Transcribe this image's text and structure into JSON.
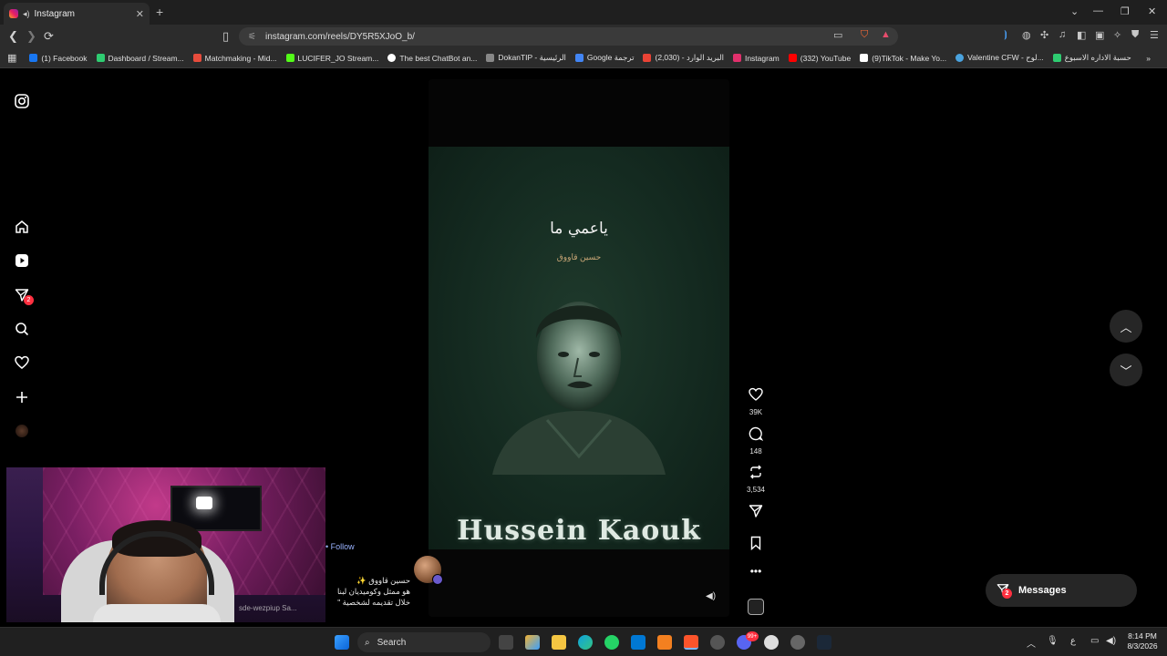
{
  "browser": {
    "tab_title": "Instagram",
    "url": "instagram.com/reels/DY5R5XJoO_b/",
    "bookmarks": [
      {
        "label": "(1) Facebook",
        "color": "#1877f2"
      },
      {
        "label": "Dashboard / Stream...",
        "color": "#2ecc71"
      },
      {
        "label": "Matchmaking - Mid...",
        "color": "#e74c3c"
      },
      {
        "label": "LUCIFER_JO Stream...",
        "color": "#53fc18"
      },
      {
        "label": "The best ChatBot an...",
        "color": "#ffffff"
      },
      {
        "label": "DokanTIP - الرئيسية",
        "color": "#888888"
      },
      {
        "label": "Google ترجمة",
        "color": "#4285f4"
      },
      {
        "label": "البريد الوارد - (2,030)",
        "color": "#ea4335"
      },
      {
        "label": "Instagram",
        "color": "#e1306c"
      },
      {
        "label": "(332) YouTube",
        "color": "#ff0000"
      },
      {
        "label": "(9)TikTok - Make Yo...",
        "color": "#ffffff"
      },
      {
        "label": "Valentine CFW - لوح...",
        "color": "#4aa3df"
      },
      {
        "label": "حسبة الاداره الاسبوع",
        "color": "#2ecc71"
      }
    ]
  },
  "reel": {
    "title": "ياعمي ما",
    "subtitle": "حسين قاووق",
    "name_art": "Hussein Kaouk",
    "likes": "39K",
    "comments": "148",
    "reposts": "3,534",
    "follow_label": "Follow",
    "caption_line1": "حسين قاووق ✨",
    "caption_line2": "هو ممثل وكوميديان لبنا",
    "caption_line3": "خلال تقديمه لشخصية \"",
    "webcam_watermark": "sde-wezpiup Sa..."
  },
  "sidebar": {
    "notification_count": "2"
  },
  "messages": {
    "label": "Messages",
    "count": "2"
  },
  "taskbar": {
    "search_placeholder": "Search",
    "discord_badge": "99+",
    "lang": "ع",
    "time": "8:14 PM",
    "date": "8/3/2026"
  }
}
